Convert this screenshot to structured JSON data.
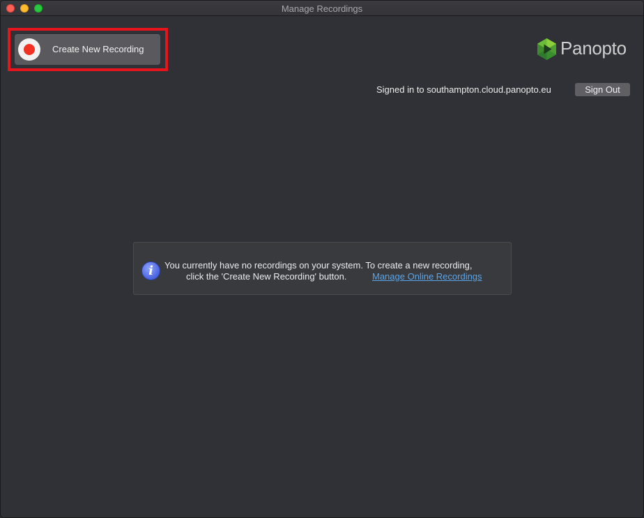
{
  "window": {
    "title": "Manage Recordings"
  },
  "toolbar": {
    "create_label": "Create New Recording"
  },
  "brand": {
    "name": "Panopto",
    "colors": {
      "green_light": "#8ccf3c",
      "green_dark": "#2f7a2c",
      "play": "#1e3a1e"
    }
  },
  "account": {
    "signed_in_text": "Signed in to southampton.cloud.panopto.eu",
    "sign_out_label": "Sign Out"
  },
  "notice": {
    "icon": "info-icon",
    "line1": "You currently have no recordings on your system. To create a new recording,",
    "line2": "click the 'Create New Recording' button.",
    "link_label": "Manage Online Recordings"
  },
  "colors": {
    "accent_red": "#e8141b",
    "record_dot": "#f03324",
    "link": "#5aa6ea",
    "background": "#303136"
  }
}
